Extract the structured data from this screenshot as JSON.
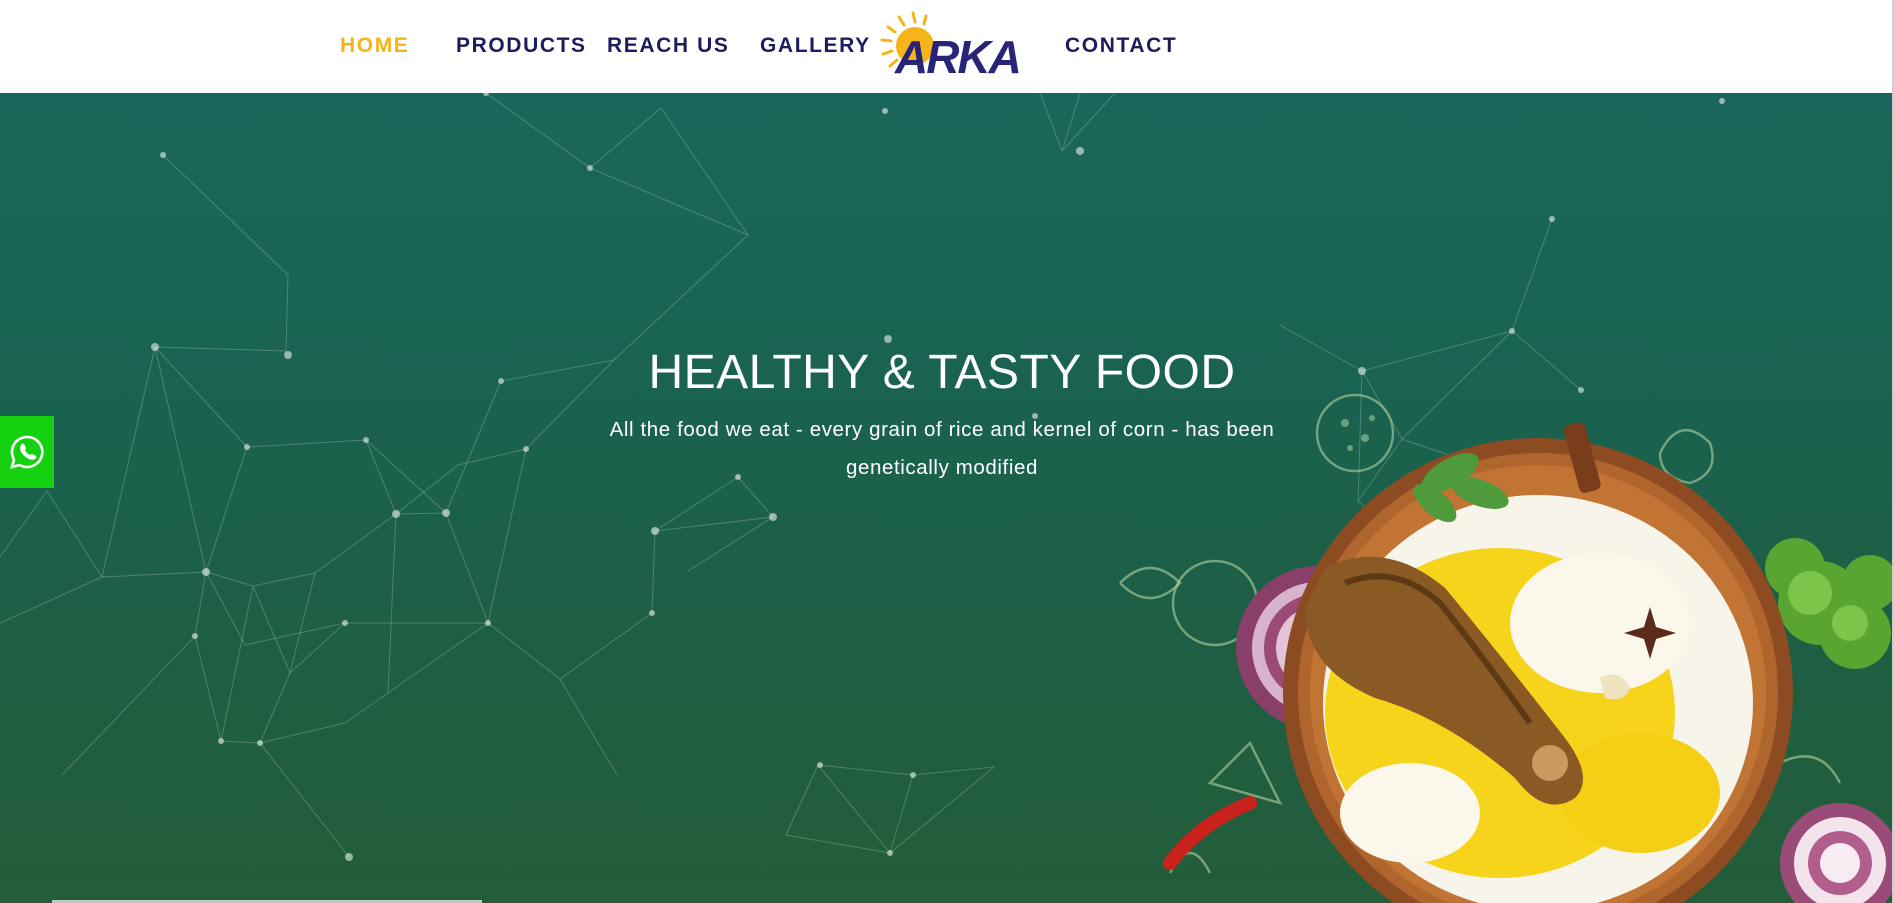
{
  "nav": {
    "home": "HOME",
    "products": "PRODUCTS",
    "reach_us": "REACH US",
    "gallery": "GALLERY",
    "contact": "CONTACT",
    "active_color": "#f4b41a",
    "text_color": "#1e1b5e"
  },
  "logo": {
    "text": "ARKA",
    "sun_color": "#f4b41a",
    "text_color": "#2a2479"
  },
  "hero": {
    "title": "HEALTHY & TASTY FOOD",
    "subtitle": "All the food we eat - every grain of rice and kernel of corn - has been genetically modified",
    "background_top": "#1b665a",
    "background_bottom": "#235d3a"
  },
  "whatsapp": {
    "icon": "whatsapp-icon",
    "color": "#16d10f"
  }
}
